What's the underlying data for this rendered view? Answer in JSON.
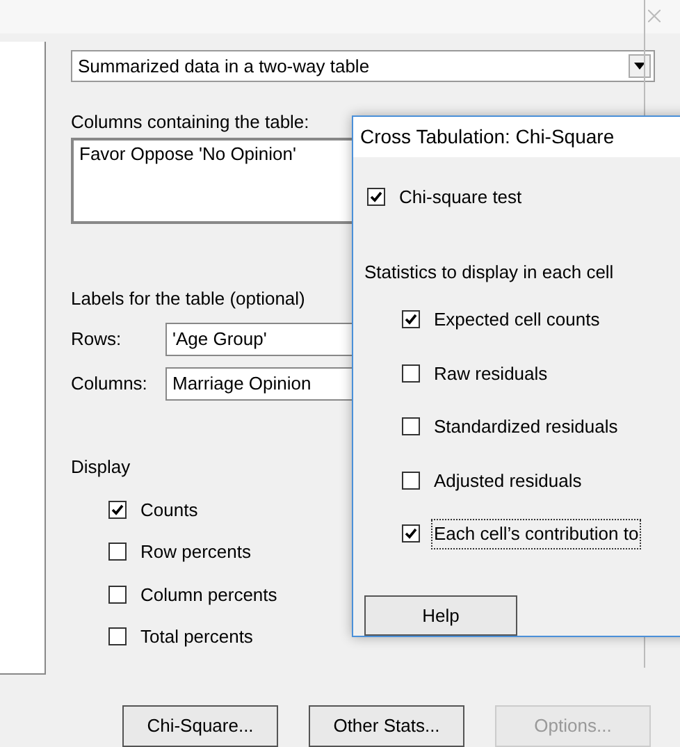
{
  "main_dialog": {
    "data_type": {
      "value": "Summarized data in a two-way table"
    },
    "columns_label": "Columns containing the table:",
    "columns_value": "Favor Oppose 'No Opinion'",
    "labels_heading": "Labels for the table (optional)",
    "label_fields": [
      {
        "label": "Rows:",
        "value": "'Age Group'"
      },
      {
        "label": "Columns:",
        "value": "Marriage Opinion"
      }
    ],
    "display_heading": "Display",
    "display_options": [
      {
        "label": "Counts",
        "checked": true
      },
      {
        "label": "Row percents",
        "checked": false
      },
      {
        "label": "Column percents",
        "checked": false
      },
      {
        "label": "Total percents",
        "checked": false
      }
    ],
    "buttons": [
      {
        "label": "Chi-Square...",
        "disabled": false
      },
      {
        "label": "Other Stats...",
        "disabled": false
      },
      {
        "label": "Options...",
        "disabled": true
      }
    ]
  },
  "sub_dialog": {
    "title": "Cross Tabulation: Chi-Square",
    "test_option": {
      "label": "Chi-square test",
      "checked": true
    },
    "stats_heading": "Statistics to display in each cell",
    "stats_options": [
      {
        "label": "Expected cell counts",
        "checked": true,
        "focused": false
      },
      {
        "label": "Raw residuals",
        "checked": false,
        "focused": false
      },
      {
        "label": "Standardized residuals",
        "checked": false,
        "focused": false
      },
      {
        "label": "Adjusted residuals",
        "checked": false,
        "focused": false
      },
      {
        "label": "Each cell’s contribution to",
        "checked": true,
        "focused": true
      }
    ],
    "help_button": "Help"
  }
}
